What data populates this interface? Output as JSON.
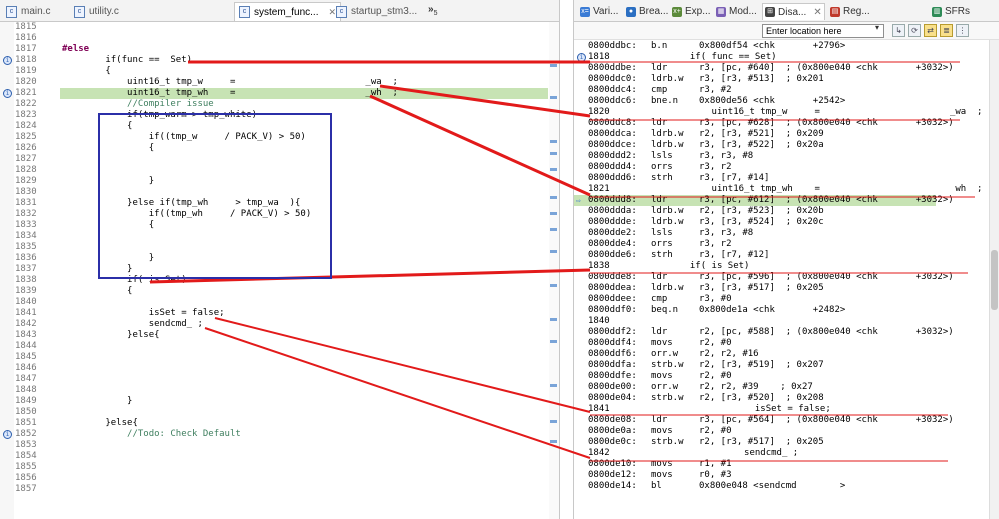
{
  "editor": {
    "tabs": [
      {
        "label": "main.c",
        "active": false
      },
      {
        "label": "utility.c",
        "active": false
      },
      {
        "label": "system_func...",
        "active": true
      },
      {
        "label": "startup_stm3...",
        "active": false
      }
    ],
    "overflow_label": "»",
    "overflow_count": "5",
    "lines": [
      {
        "n": "1815",
        "code": ""
      },
      {
        "n": "1816",
        "code": ""
      },
      {
        "n": "1817",
        "code": "#else",
        "kind": "kw"
      },
      {
        "n": "1818",
        "code": "        if(func ==  Set)",
        "bp": true
      },
      {
        "n": "1819",
        "code": "        {"
      },
      {
        "n": "1820",
        "code": "            uint16_t tmp_w     =                        _wa  ;"
      },
      {
        "n": "1821",
        "code": "            uint16_t tmp_wh    =                        _wh  ;",
        "hl": true,
        "bp": true
      },
      {
        "n": "1822",
        "code": "            //Compiler issue",
        "kind": "cm"
      },
      {
        "n": "1823",
        "code": "            if(tmp_warm > tmp_white)"
      },
      {
        "n": "1824",
        "code": "            {"
      },
      {
        "n": "1825",
        "code": "                if((tmp_w     / PACK_V) > 50)"
      },
      {
        "n": "1826",
        "code": "                {"
      },
      {
        "n": "1827",
        "code": ""
      },
      {
        "n": "1828",
        "code": ""
      },
      {
        "n": "1829",
        "code": "                }"
      },
      {
        "n": "1830",
        "code": ""
      },
      {
        "n": "1831",
        "code": "            }else if(tmp_wh     > tmp_wa  ){"
      },
      {
        "n": "1832",
        "code": "                if((tmp_wh     / PACK_V) > 50)"
      },
      {
        "n": "1833",
        "code": "                {"
      },
      {
        "n": "1834",
        "code": ""
      },
      {
        "n": "1835",
        "code": ""
      },
      {
        "n": "1836",
        "code": "                }"
      },
      {
        "n": "1837",
        "code": "            }"
      },
      {
        "n": "1838",
        "code": "            if( is Set)"
      },
      {
        "n": "1839",
        "code": "            {"
      },
      {
        "n": "1840",
        "code": ""
      },
      {
        "n": "1841",
        "code": "                isSet = false;"
      },
      {
        "n": "1842",
        "code": "                sendcmd_ ;"
      },
      {
        "n": "1843",
        "code": "            }else{"
      },
      {
        "n": "1844",
        "code": ""
      },
      {
        "n": "1845",
        "code": ""
      },
      {
        "n": "1846",
        "code": ""
      },
      {
        "n": "1847",
        "code": ""
      },
      {
        "n": "1848",
        "code": ""
      },
      {
        "n": "1849",
        "code": "            }"
      },
      {
        "n": "1850",
        "code": ""
      },
      {
        "n": "1851",
        "code": "        }else{"
      },
      {
        "n": "1852",
        "code": "            //Todo: Check Default",
        "kind": "cm",
        "bp": true
      },
      {
        "n": "1853",
        "code": ""
      },
      {
        "n": "1854",
        "code": ""
      },
      {
        "n": "1855",
        "code": ""
      },
      {
        "n": "1856",
        "code": ""
      },
      {
        "n": "1857",
        "code": ""
      }
    ]
  },
  "views": {
    "tabs": [
      {
        "label": "Vari...",
        "icon_color": "#3a7bd5"
      },
      {
        "label": "Brea...",
        "icon_color": "#2b6fc2"
      },
      {
        "label": "Exp...",
        "icon_color": "#5b8a3a"
      },
      {
        "label": "Mod...",
        "icon_color": "#7a5fb5"
      },
      {
        "label": "Disa...",
        "icon_color": "#444444",
        "active": true
      },
      {
        "label": "Reg...",
        "icon_color": "#c0392b"
      },
      {
        "label": "SFRs",
        "icon_color": "#2e8b57"
      }
    ],
    "location_placeholder": "Enter location here",
    "dropdown_glyph": "▾"
  },
  "disassembly": [
    {
      "t": "asm",
      "addr": "0800ddbc:",
      "mn": "b.n",
      "op": "0x800df54 <chk       +2796>"
    },
    {
      "t": "src",
      "ln": "1818",
      "src": "              if( func == Set)",
      "bp": true
    },
    {
      "t": "asm",
      "addr": "0800ddbe:",
      "mn": "ldr",
      "op": "r3, [pc, #640]  ; (0x800e040 <chk       +3032>)"
    },
    {
      "t": "asm",
      "addr": "0800ddc0:",
      "mn": "ldrb.w",
      "op": "r3, [r3, #513]  ; 0x201"
    },
    {
      "t": "asm",
      "addr": "0800ddc4:",
      "mn": "cmp",
      "op": "r3, #2"
    },
    {
      "t": "asm",
      "addr": "0800ddc6:",
      "mn": "bne.n",
      "op": "0x800de56 <chk       +2542>"
    },
    {
      "t": "src",
      "ln": "1820",
      "src": "                  uint16_t tmp_w     =                        _wa  ;"
    },
    {
      "t": "asm",
      "addr": "0800ddc8:",
      "mn": "ldr",
      "op": "r3, [pc, #628]  ; (0x800e040 <chk       +3032>)"
    },
    {
      "t": "asm",
      "addr": "0800ddca:",
      "mn": "ldrb.w",
      "op": "r2, [r3, #521]  ; 0x209"
    },
    {
      "t": "asm",
      "addr": "0800ddce:",
      "mn": "ldrb.w",
      "op": "r3, [r3, #522]  ; 0x20a"
    },
    {
      "t": "asm",
      "addr": "0800ddd2:",
      "mn": "lsls",
      "op": "r3, r3, #8"
    },
    {
      "t": "asm",
      "addr": "0800ddd4:",
      "mn": "orrs",
      "op": "r3, r2"
    },
    {
      "t": "asm",
      "addr": "0800ddd6:",
      "mn": "strh",
      "op": "r3, [r7, #14]"
    },
    {
      "t": "src",
      "ln": "1821",
      "src": "                  uint16_t tmp_wh    =                         wh  ;"
    },
    {
      "t": "asm",
      "addr": "0800ddd8:",
      "mn": "ldr",
      "op": "r3, [pc, #612]  ; (0x800e040 <chk       +3032>)",
      "cur": true
    },
    {
      "t": "asm",
      "addr": "0800ddda:",
      "mn": "ldrb.w",
      "op": "r2, [r3, #523]  ; 0x20b"
    },
    {
      "t": "asm",
      "addr": "0800ddde:",
      "mn": "ldrb.w",
      "op": "r3, [r3, #524]  ; 0x20c"
    },
    {
      "t": "asm",
      "addr": "0800dde2:",
      "mn": "lsls",
      "op": "r3, r3, #8"
    },
    {
      "t": "asm",
      "addr": "0800dde4:",
      "mn": "orrs",
      "op": "r3, r2"
    },
    {
      "t": "asm",
      "addr": "0800dde6:",
      "mn": "strh",
      "op": "r3, [r7, #12]"
    },
    {
      "t": "src",
      "ln": "1838",
      "src": "              if( is Set)"
    },
    {
      "t": "asm",
      "addr": "0800dde8:",
      "mn": "ldr",
      "op": "r3, [pc, #596]  ; (0x800e040 <chk       +3032>)"
    },
    {
      "t": "asm",
      "addr": "0800ddea:",
      "mn": "ldrb.w",
      "op": "r3, [r3, #517]  ; 0x205"
    },
    {
      "t": "asm",
      "addr": "0800ddee:",
      "mn": "cmp",
      "op": "r3, #0"
    },
    {
      "t": "asm",
      "addr": "0800ddf0:",
      "mn": "beq.n",
      "op": "0x800de1a <chk       +2482>"
    },
    {
      "t": "src",
      "ln": "1840",
      "src": ""
    },
    {
      "t": "asm",
      "addr": "0800ddf2:",
      "mn": "ldr",
      "op": "r2, [pc, #588]  ; (0x800e040 <chk       +3032>)"
    },
    {
      "t": "asm",
      "addr": "0800ddf4:",
      "mn": "movs",
      "op": "r2, #0"
    },
    {
      "t": "asm",
      "addr": "0800ddf6:",
      "mn": "orr.w",
      "op": "r2, r2, #16"
    },
    {
      "t": "asm",
      "addr": "0800ddfa:",
      "mn": "strb.w",
      "op": "r2, [r3, #519]  ; 0x207"
    },
    {
      "t": "asm",
      "addr": "0800ddfe:",
      "mn": "movs",
      "op": "r2, #0"
    },
    {
      "t": "asm",
      "addr": "0800de00:",
      "mn": "orr.w",
      "op": "r2, r2, #39    ; 0x27"
    },
    {
      "t": "asm",
      "addr": "0800de04:",
      "mn": "strb.w",
      "op": "r2, [r3, #520]  ; 0x208"
    },
    {
      "t": "src",
      "ln": "1841",
      "src": "                          isSet = false;"
    },
    {
      "t": "asm",
      "addr": "0800de08:",
      "mn": "ldr",
      "op": "r3, [pc, #564]  ; (0x800e040 <chk       +3032>)"
    },
    {
      "t": "asm",
      "addr": "0800de0a:",
      "mn": "movs",
      "op": "r2, #0"
    },
    {
      "t": "asm",
      "addr": "0800de0c:",
      "mn": "strb.w",
      "op": "r2, [r3, #517]  ; 0x205"
    },
    {
      "t": "src",
      "ln": "1842",
      "src": "                        sendcmd_ ;"
    },
    {
      "t": "asm",
      "addr": "0800de10:",
      "mn": "movs",
      "op": "r1, #1"
    },
    {
      "t": "asm",
      "addr": "0800de12:",
      "mn": "movs",
      "op": "r0, #3"
    },
    {
      "t": "asm",
      "addr": "0800de14:",
      "mn": "bl",
      "op": "0x800e048 <sendcmd        >"
    }
  ]
}
